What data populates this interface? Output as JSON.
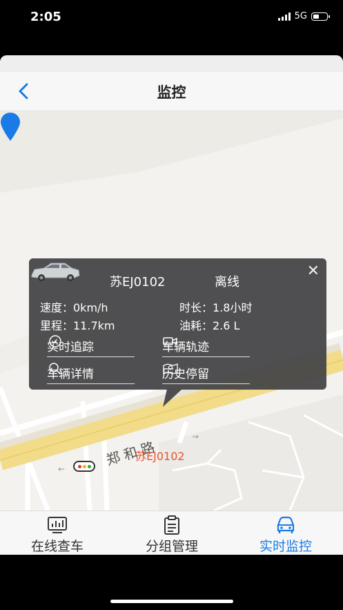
{
  "status_bar": {
    "time": "2:05",
    "network": "5G"
  },
  "header": {
    "title": "监控",
    "back_icon": "chevron-left-icon"
  },
  "map": {
    "road_name": "郑和路",
    "vehicle_marker_label": "苏EJ0102"
  },
  "popup": {
    "plate": "苏EJ0102",
    "status": "离线",
    "speed": "速度：0km/h",
    "duration": "时长：1.8小时",
    "mileage": "里程：11.7km",
    "fuel": "油耗：2.6 L",
    "actions": [
      {
        "label": "实时追踪",
        "icon": "compass-icon"
      },
      {
        "label": "车辆轨迹",
        "icon": "video-icon"
      },
      {
        "label": "车辆详情",
        "icon": "search-icon"
      },
      {
        "label": "历史停留",
        "icon": "map-pin-icon"
      }
    ]
  },
  "tabs": [
    {
      "label": "在线查车",
      "icon": "chart-icon",
      "active": false
    },
    {
      "label": "分组管理",
      "icon": "clipboard-icon",
      "active": false
    },
    {
      "label": "实时监控",
      "icon": "car-icon",
      "active": true
    }
  ],
  "colors": {
    "accent": "#1a7be8",
    "popup_bg": "#464648",
    "road": "#f2dc8a",
    "marker": "#1a7be8"
  }
}
